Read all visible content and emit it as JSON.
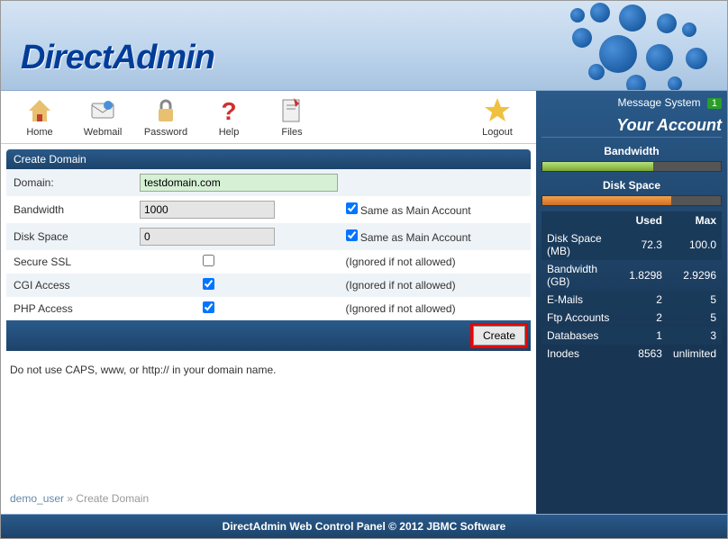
{
  "brand": "DirectAdmin",
  "toolbar": [
    {
      "name": "home",
      "label": "Home"
    },
    {
      "name": "webmail",
      "label": "Webmail"
    },
    {
      "name": "password",
      "label": "Password"
    },
    {
      "name": "help",
      "label": "Help"
    },
    {
      "name": "files",
      "label": "Files"
    },
    {
      "name": "logout",
      "label": "Logout"
    }
  ],
  "panel": {
    "title": "Create Domain",
    "domain_label": "Domain:",
    "domain_value": "testdomain.com",
    "bandwidth_label": "Bandwidth",
    "bandwidth_value": "1000",
    "diskspace_label": "Disk Space",
    "diskspace_value": "0",
    "same_as_main": "Same as Main Account",
    "ssl_label": "Secure SSL",
    "cgi_label": "CGI Access",
    "php_label": "PHP Access",
    "ignored": "(Ignored if not allowed)",
    "submit": "Create"
  },
  "note": "Do not use CAPS, www, or http:// in your domain name.",
  "breadcrumb": {
    "user": "demo_user",
    "sep": "»",
    "page": "Create Domain"
  },
  "sidebar": {
    "message_system": "Message System",
    "message_count": "1",
    "title": "Your Account",
    "bandwidth_label": "Bandwidth",
    "diskspace_label": "Disk Space",
    "headers": {
      "used": "Used",
      "max": "Max"
    },
    "rows": [
      {
        "label": "Disk Space (MB)",
        "used": "72.3",
        "max": "100.0"
      },
      {
        "label": "Bandwidth (GB)",
        "used": "1.8298",
        "max": "2.9296"
      },
      {
        "label": "E-Mails",
        "used": "2",
        "max": "5"
      },
      {
        "label": "Ftp Accounts",
        "used": "2",
        "max": "5"
      },
      {
        "label": "Databases",
        "used": "1",
        "max": "3"
      },
      {
        "label": "Inodes",
        "used": "8563",
        "max": "unlimited"
      }
    ]
  },
  "footer": "DirectAdmin Web Control Panel © 2012 JBMC Software"
}
